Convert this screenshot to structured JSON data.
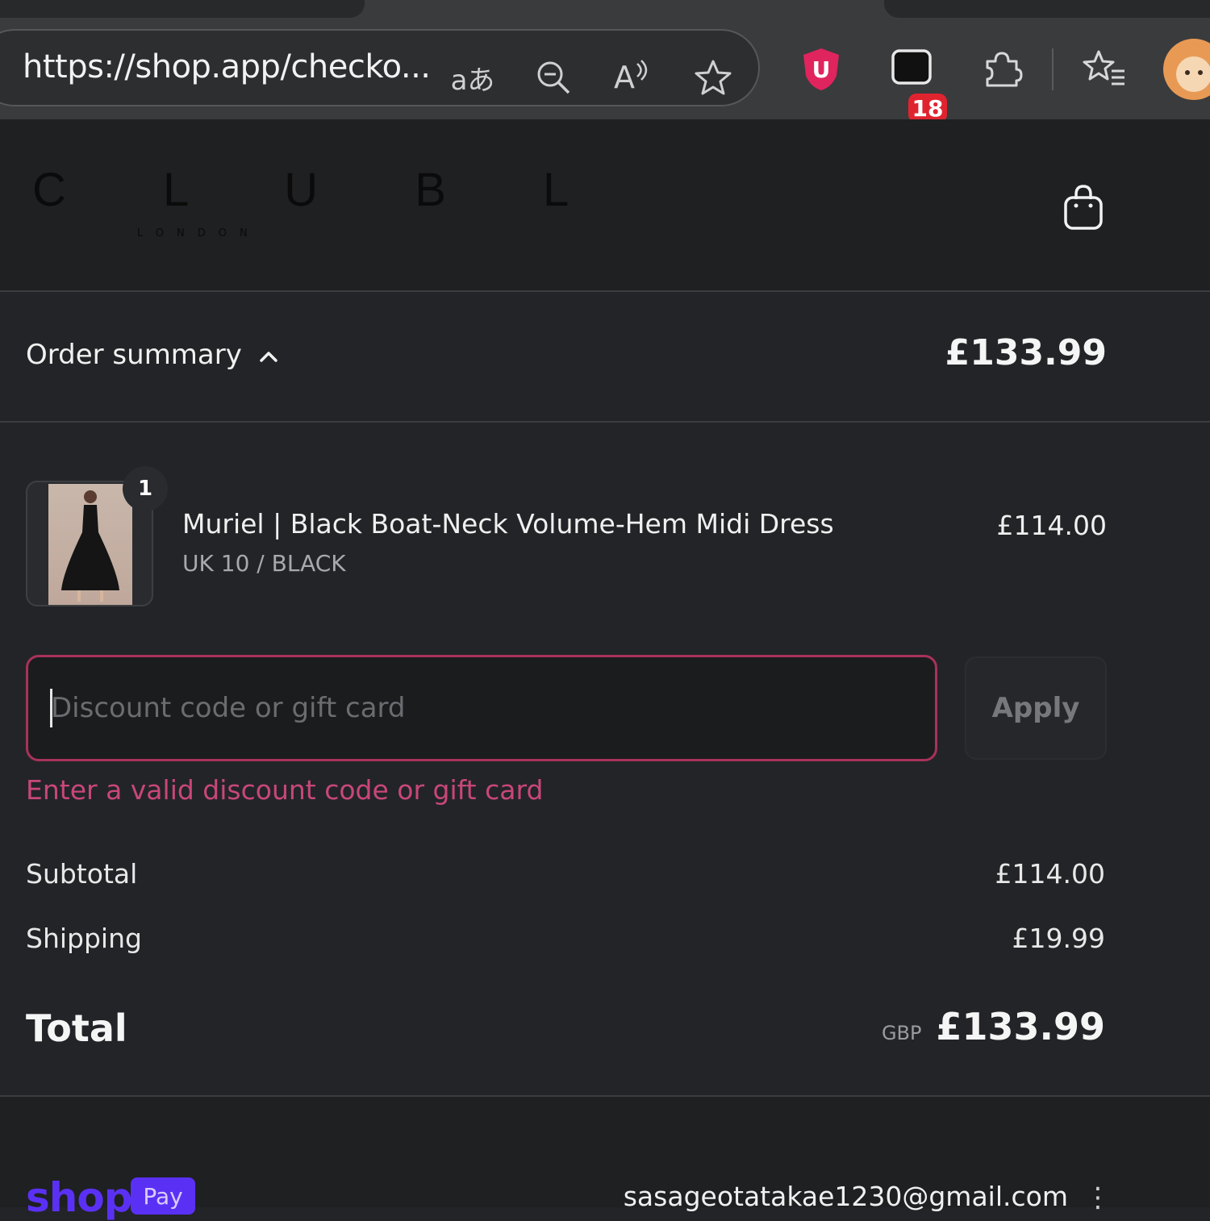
{
  "browser": {
    "url": "https://shop.app/checko...",
    "icons": [
      "translate-icon",
      "zoom-out-icon",
      "read-aloud-icon",
      "favorite-star-icon",
      "ublock-icon",
      "extension-badge-icon",
      "extensions-puzzle-icon",
      "favorites-icon",
      "profile-avatar"
    ],
    "translate_glyph": "aあ",
    "read_aloud_glyph": "A",
    "ublock_letter": "U",
    "extension_badge": "18",
    "colors": {
      "ublock": "#e0245e",
      "badge": "#e0242f"
    }
  },
  "store": {
    "logo": "C L U B L",
    "logo_sub": "LONDON"
  },
  "summary": {
    "label": "Order summary",
    "total": "£133.99"
  },
  "item": {
    "quantity": "1",
    "title": "Muriel | Black Boat-Neck Volume-Hem Midi Dress",
    "variant": "UK 10 / BLACK",
    "price": "£114.00"
  },
  "discount": {
    "placeholder": "Discount code or gift card",
    "value": "",
    "apply_label": "Apply",
    "error": "Enter a valid discount code or gift card"
  },
  "totals": {
    "subtotal_label": "Subtotal",
    "subtotal_value": "£114.00",
    "shipping_label": "Shipping",
    "shipping_value": "£19.99",
    "total_label": "Total",
    "currency": "GBP",
    "total_value": "£133.99"
  },
  "footer": {
    "brand": "shop",
    "pay": "Pay",
    "email": "sasageotatakae1230@gmail.com",
    "more_glyph": "⋮",
    "colors": {
      "shop_pay": "#5a31f4"
    }
  }
}
